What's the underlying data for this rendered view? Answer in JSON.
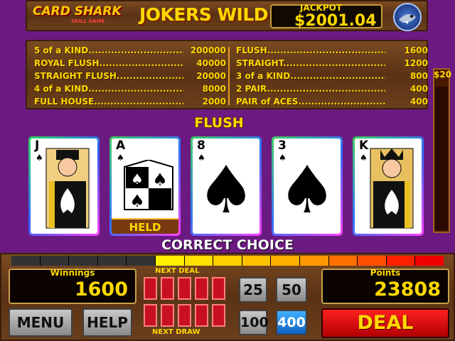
{
  "header": {
    "logo": "CARD SHARK",
    "logo_sub": "SKILL GAME",
    "title": "JOKERS WILD",
    "jackpot_label": "JACKPOT",
    "jackpot_value": "$2001.04"
  },
  "paytable": {
    "left": [
      {
        "name": "5 of a KIND....................................",
        "value": "200000"
      },
      {
        "name": "ROYAL FLUSH................................",
        "value": "40000"
      },
      {
        "name": "STRAIGHT FLUSH..........................",
        "value": "20000"
      },
      {
        "name": "4 of a KIND....................................",
        "value": "8000"
      },
      {
        "name": "FULL HOUSE.................................",
        "value": "2000"
      }
    ],
    "right": [
      {
        "name": "FLUSH..............................................",
        "value": "1600"
      },
      {
        "name": "STRAIGHT........................................",
        "value": "1200"
      },
      {
        "name": "3 of a KIND....................................",
        "value": "800"
      },
      {
        "name": "2 PAIR...........................................",
        "value": "400"
      },
      {
        "name": "PAIR of ACES...................................",
        "value": "400"
      }
    ]
  },
  "bet_label": "$20",
  "hand_result": "FLUSH",
  "message": "CORRECT CHOICE",
  "cards": [
    {
      "rank": "J",
      "suit": "♠",
      "held": false,
      "face": "jack"
    },
    {
      "rank": "A",
      "suit": "♠",
      "held": true,
      "face": "ace"
    },
    {
      "rank": "8",
      "suit": "♠",
      "held": false,
      "face": "pip"
    },
    {
      "rank": "3",
      "suit": "♠",
      "held": false,
      "face": "pip"
    },
    {
      "rank": "K",
      "suit": "♠",
      "held": false,
      "face": "king"
    }
  ],
  "held_label": "HELD",
  "winnings": {
    "label": "Winnings",
    "value": "1600"
  },
  "points": {
    "label": "Points",
    "value": "23808"
  },
  "next_deal_label": "NEXT DEAL",
  "next_draw_label": "NEXT DRAW",
  "buttons": {
    "menu": "MENU",
    "help": "HELP",
    "bet25": "25",
    "bet50": "50",
    "bet100": "100",
    "bet400": "400",
    "deal": "DEAL"
  },
  "colors": {
    "background": "#6a1a80",
    "accent": "#ffd800",
    "deal": "#e01010",
    "selected_bet": "#1a90e0"
  }
}
